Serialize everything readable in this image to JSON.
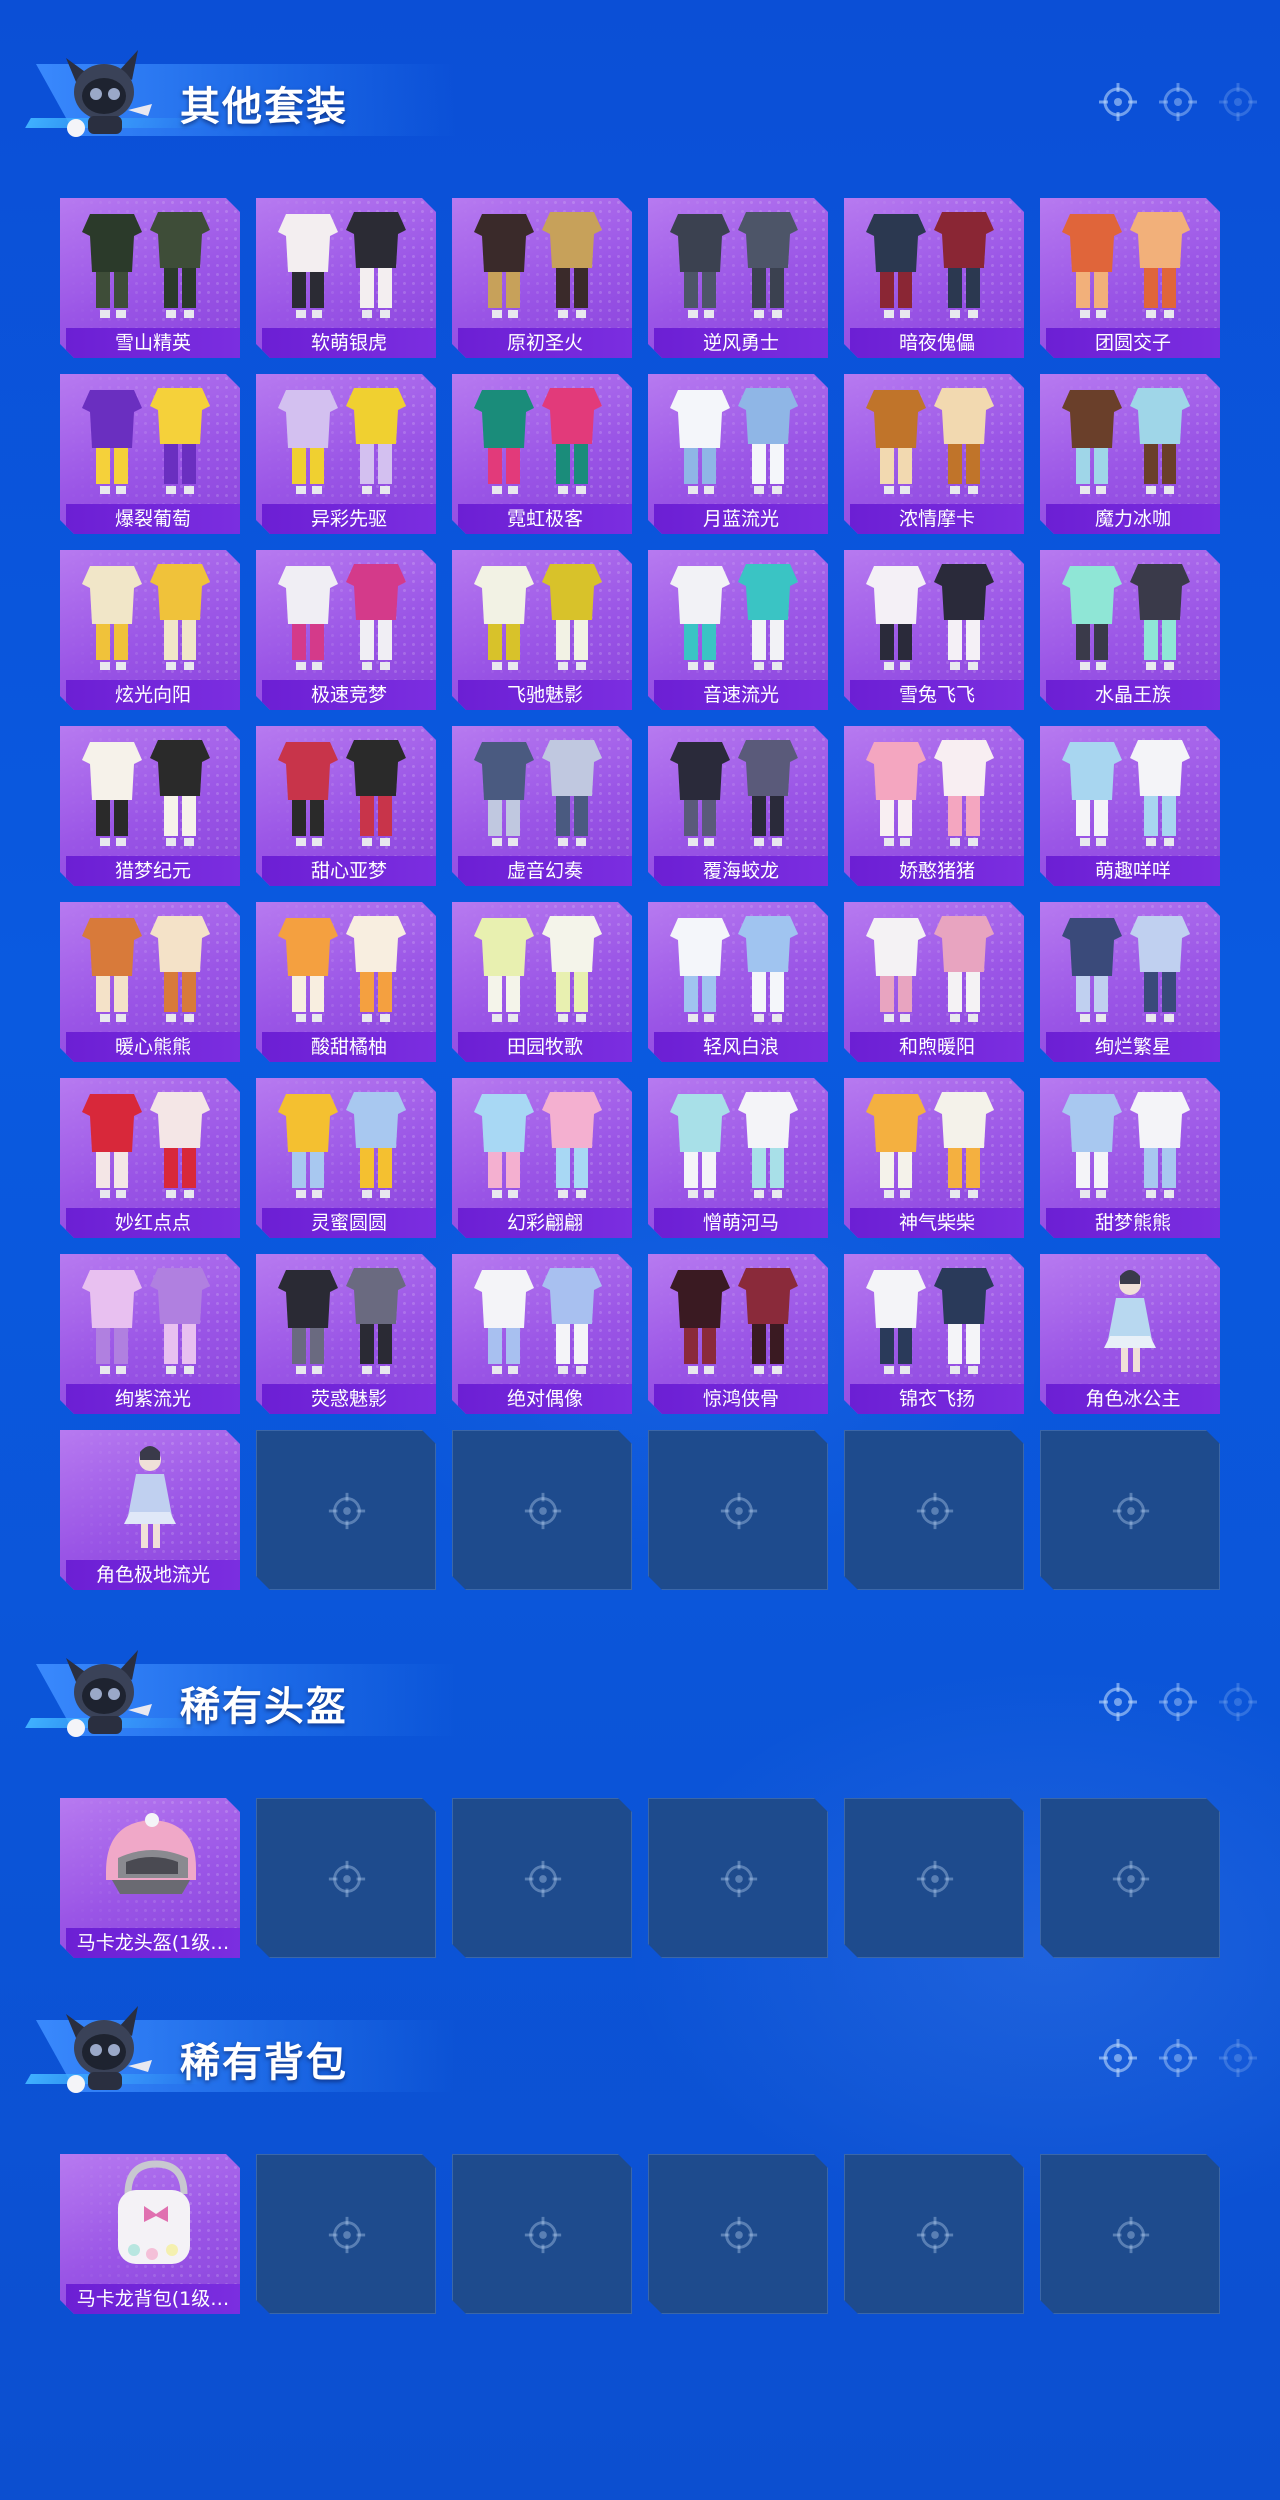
{
  "sections": [
    {
      "title": "其他套装",
      "items": [
        {
          "label": "雪山精英",
          "filled": true,
          "colors": [
            "#2b3a2a",
            "#3e4d38"
          ]
        },
        {
          "label": "软萌银虎",
          "filled": true,
          "colors": [
            "#f3eef0",
            "#2b2b34"
          ]
        },
        {
          "label": "原初圣火",
          "filled": true,
          "colors": [
            "#3a2a2a",
            "#c7a15a"
          ]
        },
        {
          "label": "逆风勇士",
          "filled": true,
          "colors": [
            "#3b4150",
            "#4d5568"
          ]
        },
        {
          "label": "暗夜傀儡",
          "filled": true,
          "colors": [
            "#2b3850",
            "#8a2634"
          ]
        },
        {
          "label": "团圆交子",
          "filled": true,
          "colors": [
            "#e0653a",
            "#f2b07a"
          ]
        },
        {
          "label": "爆裂葡萄",
          "filled": true,
          "colors": [
            "#6a2fc0",
            "#f5d13a"
          ]
        },
        {
          "label": "异彩先驱",
          "filled": true,
          "colors": [
            "#d3c0f0",
            "#f0d030"
          ]
        },
        {
          "label": "霓虹极客",
          "filled": true,
          "colors": [
            "#1a8c7a",
            "#e23a7a"
          ]
        },
        {
          "label": "月蓝流光",
          "filled": true,
          "colors": [
            "#f4f6fa",
            "#8fb6e6"
          ]
        },
        {
          "label": "浓情摩卡",
          "filled": true,
          "colors": [
            "#c0742a",
            "#f2d9b0"
          ]
        },
        {
          "label": "魔力冰咖",
          "filled": true,
          "colors": [
            "#6a3f2a",
            "#9fd6e8"
          ]
        },
        {
          "label": "炫光向阳",
          "filled": true,
          "colors": [
            "#f1e6c8",
            "#f0c23a"
          ]
        },
        {
          "label": "极速竞梦",
          "filled": true,
          "colors": [
            "#f0eef4",
            "#d43a8a"
          ]
        },
        {
          "label": "飞驰魅影",
          "filled": true,
          "colors": [
            "#f2f2e4",
            "#d8c22a"
          ]
        },
        {
          "label": "音速流光",
          "filled": true,
          "colors": [
            "#f2f2f6",
            "#3ac4c4"
          ]
        },
        {
          "label": "雪兔飞飞",
          "filled": true,
          "colors": [
            "#f4f0f6",
            "#2a2a3a"
          ]
        },
        {
          "label": "水晶王族",
          "filled": true,
          "colors": [
            "#8fe6d6",
            "#3a3a4a"
          ]
        },
        {
          "label": "猎梦纪元",
          "filled": true,
          "colors": [
            "#f6f2ea",
            "#2a2a2a"
          ]
        },
        {
          "label": "甜心亚梦",
          "filled": true,
          "colors": [
            "#c8344a",
            "#2a2a2a"
          ]
        },
        {
          "label": "虚音幻奏",
          "filled": true,
          "colors": [
            "#4a5a80",
            "#c0c8e0"
          ]
        },
        {
          "label": "覆海蛟龙",
          "filled": true,
          "colors": [
            "#2a2a3a",
            "#5a5a7a"
          ]
        },
        {
          "label": "娇憨猪猪",
          "filled": true,
          "colors": [
            "#f4a6c0",
            "#f8eef2"
          ]
        },
        {
          "label": "萌趣咩咩",
          "filled": true,
          "colors": [
            "#a8d6f0",
            "#f4f4f8"
          ]
        },
        {
          "label": "暖心熊熊",
          "filled": true,
          "colors": [
            "#d87a3a",
            "#f4e2c8"
          ]
        },
        {
          "label": "酸甜橘柚",
          "filled": true,
          "colors": [
            "#f4a040",
            "#f8eee0"
          ]
        },
        {
          "label": "田园牧歌",
          "filled": true,
          "colors": [
            "#e8f0b0",
            "#f4f4ea"
          ]
        },
        {
          "label": "轻风白浪",
          "filled": true,
          "colors": [
            "#f4f6fa",
            "#a0c4f0"
          ]
        },
        {
          "label": "和煦暖阳",
          "filled": true,
          "colors": [
            "#f4f2f4",
            "#e8a4c0"
          ]
        },
        {
          "label": "绚烂繁星",
          "filled": true,
          "colors": [
            "#3a4a7a",
            "#c0d0f0"
          ]
        },
        {
          "label": "妙红点点",
          "filled": true,
          "colors": [
            "#d8283a",
            "#f4e6e6"
          ]
        },
        {
          "label": "灵蜜圆圆",
          "filled": true,
          "colors": [
            "#f4c030",
            "#a8c8f0"
          ]
        },
        {
          "label": "幻彩翩翩",
          "filled": true,
          "colors": [
            "#a8d8f4",
            "#f4b0d0"
          ]
        },
        {
          "label": "憎萌河马",
          "filled": true,
          "colors": [
            "#a8e0e8",
            "#f4f4f8"
          ]
        },
        {
          "label": "神气柴柴",
          "filled": true,
          "colors": [
            "#f4b040",
            "#f4f2ea"
          ]
        },
        {
          "label": "甜梦熊熊",
          "filled": true,
          "colors": [
            "#a8c8f0",
            "#f4f4f8"
          ]
        },
        {
          "label": "绚紫流光",
          "filled": true,
          "colors": [
            "#e8c0f0",
            "#b080e0"
          ]
        },
        {
          "label": "荧惑魅影",
          "filled": true,
          "colors": [
            "#2a2a34",
            "#6a6a80"
          ]
        },
        {
          "label": "绝对偶像",
          "filled": true,
          "colors": [
            "#f4f4f8",
            "#a8c0f0"
          ]
        },
        {
          "label": "惊鸿侠骨",
          "filled": true,
          "colors": [
            "#3a1a22",
            "#8a2a3a"
          ]
        },
        {
          "label": "锦衣飞扬",
          "filled": true,
          "colors": [
            "#f4f4f8",
            "#2a3a5a"
          ]
        },
        {
          "label": "角色冰公主",
          "filled": true,
          "colors": [
            "#b8d8f0",
            "#e8f0f8"
          ]
        },
        {
          "label": "角色极地流光",
          "filled": true,
          "colors": [
            "#c0d0f0",
            "#e0e8f8"
          ]
        },
        {
          "label": "",
          "filled": false
        },
        {
          "label": "",
          "filled": false
        },
        {
          "label": "",
          "filled": false
        },
        {
          "label": "",
          "filled": false
        },
        {
          "label": "",
          "filled": false
        }
      ]
    },
    {
      "title": "稀有头盔",
      "items": [
        {
          "label": "马卡龙头盔(1级…",
          "filled": true,
          "icon": "helmet-icon",
          "colors": [
            "#f0a8c8",
            "#8a8a90"
          ]
        },
        {
          "label": "",
          "filled": false
        },
        {
          "label": "",
          "filled": false
        },
        {
          "label": "",
          "filled": false
        },
        {
          "label": "",
          "filled": false
        },
        {
          "label": "",
          "filled": false
        }
      ]
    },
    {
      "title": "稀有背包",
      "items": [
        {
          "label": "马卡龙背包(1级…",
          "filled": true,
          "icon": "backpack-icon",
          "colors": [
            "#f4f2f6",
            "#e070b0"
          ]
        },
        {
          "label": "",
          "filled": false
        },
        {
          "label": "",
          "filled": false
        },
        {
          "label": "",
          "filled": false
        },
        {
          "label": "",
          "filled": false
        },
        {
          "label": "",
          "filled": false
        }
      ]
    }
  ],
  "theme": {
    "background": "#0b55da",
    "tile_filled": "#a064ea",
    "tile_label": "#6c1fd4",
    "tile_empty": "#1e4b8d"
  }
}
